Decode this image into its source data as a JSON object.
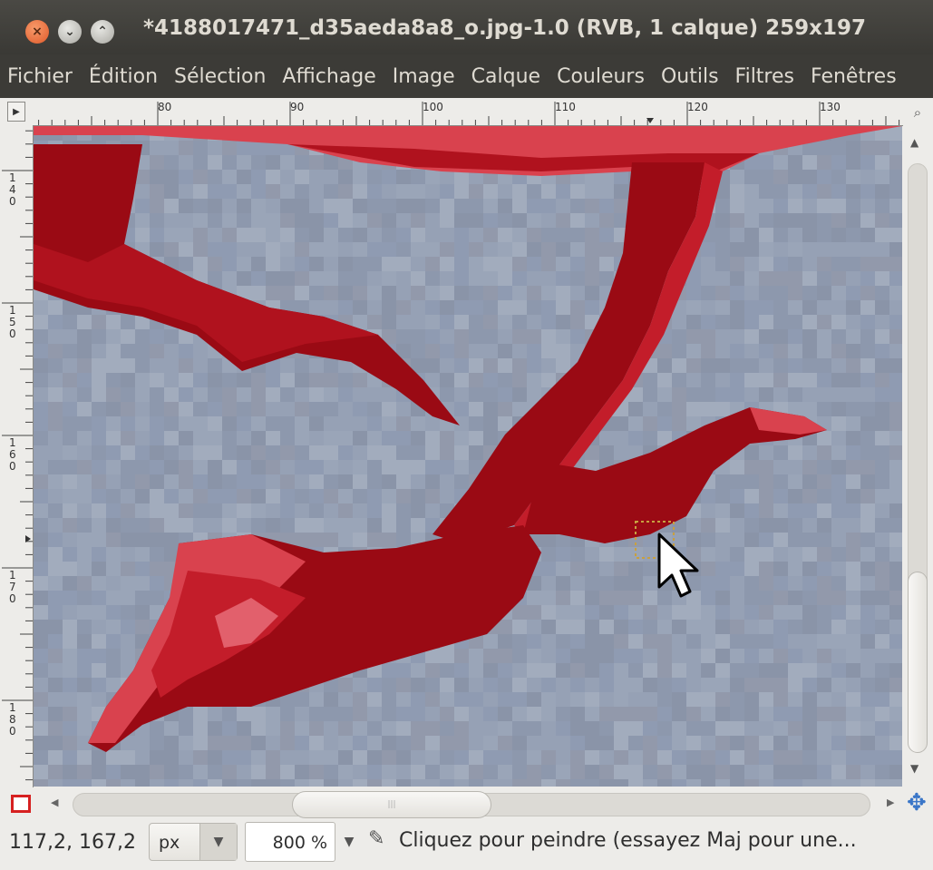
{
  "window": {
    "title": "*4188017471_d35aeda8a8_o.jpg-1.0 (RVB, 1 calque) 259x197",
    "close_glyph": "×",
    "min_glyph": "⌄",
    "max_glyph": "⌃"
  },
  "menu": {
    "items": [
      "Fichier",
      "Édition",
      "Sélection",
      "Affichage",
      "Image",
      "Calque",
      "Couleurs",
      "Outils",
      "Filtres",
      "Fenêtres"
    ]
  },
  "rulers": {
    "horizontal_labels": [
      "80",
      "90",
      "100",
      "110",
      "120",
      "130"
    ],
    "vertical_labels": [
      "140",
      "150",
      "160",
      "170",
      "180"
    ]
  },
  "statusbar": {
    "coords": "117,2, 167,2",
    "unit": "px",
    "zoom": "800 %",
    "message": "Cliquez pour peindre (essayez Maj pour une..."
  },
  "icons": {
    "ruler_corner": "triangle-right-icon",
    "navigate": "magnifier-icon",
    "quickmask": "quick-mask-icon",
    "move": "navigate-icon",
    "brush": "brush-icon"
  },
  "colors": {
    "canvas_bg": "#919cb0",
    "red_dark": "#9a0a14",
    "red_light": "#d9424e",
    "titlebar": "#3c3b37"
  }
}
